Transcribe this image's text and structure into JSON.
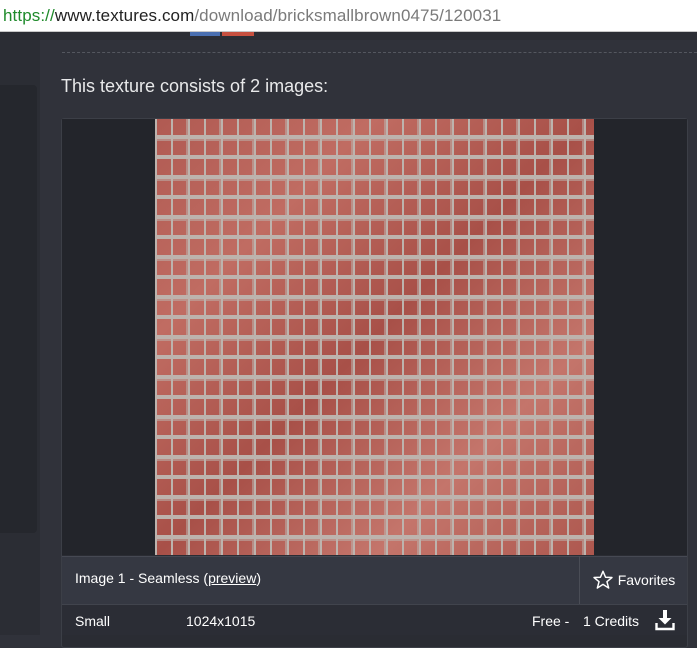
{
  "address_bar": {
    "scheme": "https://",
    "domain": "www.textures.com",
    "path": "/download/bricksmallbrown0475/120031"
  },
  "main": {
    "heading": "This texture consists of 2 images:"
  },
  "image1": {
    "label": "Image 1 - Seamless (",
    "preview_link": "preview",
    "label_end": ")",
    "favorites_label": "Favorites",
    "favorites_icon": "star-outline-icon",
    "preview_alt": "brick-wall-texture"
  },
  "download": {
    "size": "Small",
    "resolution": "1024x1015",
    "free": "Free -",
    "credits": "1 Credits",
    "icon": "download-icon"
  },
  "colors": {
    "page_bg": "#30323a",
    "card_bg": "#2a2c33",
    "text": "#ffffff",
    "url_scheme": "#1e8a2a"
  }
}
